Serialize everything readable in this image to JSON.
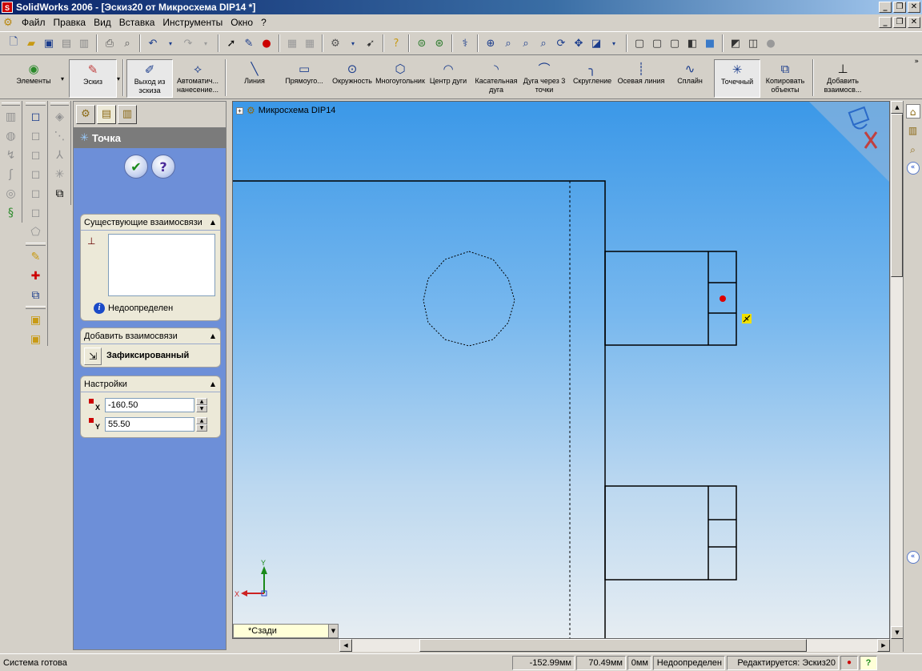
{
  "window": {
    "title": "SolidWorks 2006 - [Эскиз20 от Микросхема DIP14 *]",
    "app_icon": "solidworks-logo-icon"
  },
  "menu": [
    "Файл",
    "Правка",
    "Вид",
    "Вставка",
    "Инструменты",
    "Окно",
    "?"
  ],
  "command_manager": {
    "elements_label": "Элементы",
    "sketch_label": "Эскиз",
    "exit_sketch": "Выход из эскиза",
    "auto_dims": "Автоматич... нанесение...",
    "tools": [
      {
        "label": "Линия",
        "icon": "line-icon"
      },
      {
        "label": "Прямоуго...",
        "icon": "rectangle-icon"
      },
      {
        "label": "Окружность",
        "icon": "circle-icon"
      },
      {
        "label": "Многоугольник",
        "icon": "polygon-icon"
      },
      {
        "label": "Центр дуги",
        "icon": "center-arc-icon"
      },
      {
        "label": "Касательная дуга",
        "icon": "tangent-arc-icon"
      },
      {
        "label": "Дуга через 3 точки",
        "icon": "three-point-arc-icon"
      },
      {
        "label": "Скругление",
        "icon": "fillet-icon"
      },
      {
        "label": "Осевая линия",
        "icon": "centerline-icon"
      },
      {
        "label": "Сплайн",
        "icon": "spline-icon"
      },
      {
        "label": "Точечный",
        "icon": "point-icon"
      },
      {
        "label": "Копировать объекты",
        "icon": "copy-entities-icon"
      },
      {
        "label": "Добавить взаимосв...",
        "icon": "add-relation-icon"
      }
    ]
  },
  "property_manager": {
    "title": "Точка",
    "existing_relations": {
      "header": "Существующие взаимосвязи",
      "status": "Недоопределен"
    },
    "add_relations": {
      "header": "Добавить взаимосвязи",
      "fixed_label": "Зафиксированный"
    },
    "settings": {
      "header": "Настройки",
      "x_axis": "X",
      "y_axis": "Y",
      "x_value": "-160.50",
      "y_value": "55.50"
    }
  },
  "graphics": {
    "tree_node": "Микросхема DIP14",
    "view_orientation": "*Сзади",
    "triad_x": "X",
    "triad_y": "Y"
  },
  "status_bar": {
    "message": "Система готова",
    "x_coord": "-152.99мм",
    "y_coord": "70.49мм",
    "z_coord": "0мм",
    "sketch_state": "Недоопределен",
    "editing": "Редактируется: Эскиз20"
  },
  "colors": {
    "title_bar": "#0a246a",
    "point_marker": "#dd0000",
    "fixed_marker": "#f0e000"
  }
}
